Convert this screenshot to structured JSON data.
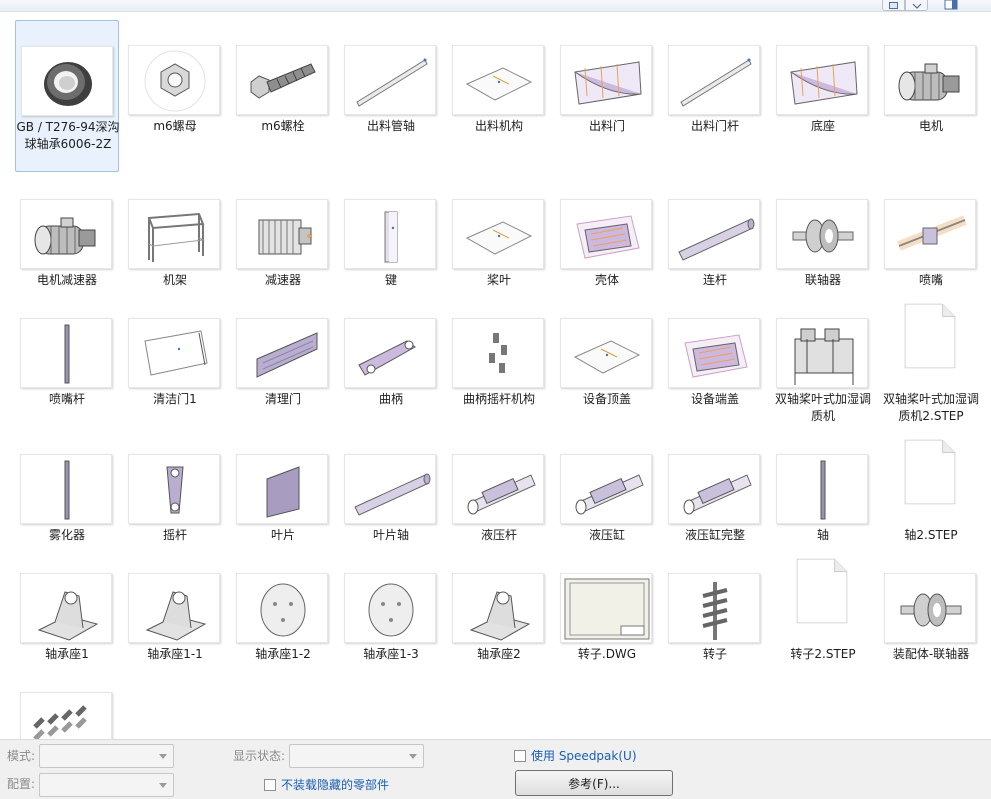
{
  "files": [
    {
      "label": "GB / T276-94深沟球轴承6006-2Z",
      "icon": "bearing-icon",
      "selected": true
    },
    {
      "label": "m6螺母",
      "icon": "nut-icon"
    },
    {
      "label": "m6螺栓",
      "icon": "bolt-icon"
    },
    {
      "label": "出料管轴",
      "icon": "rod-icon"
    },
    {
      "label": "出料机构",
      "icon": "sheet-icon"
    },
    {
      "label": "出料门",
      "icon": "trough-icon"
    },
    {
      "label": "出料门杆",
      "icon": "rod-icon"
    },
    {
      "label": "底座",
      "icon": "trough-icon"
    },
    {
      "label": "电机",
      "icon": "motor-icon"
    },
    {
      "label": "电机减速器",
      "icon": "motor-icon"
    },
    {
      "label": "机架",
      "icon": "frame-icon"
    },
    {
      "label": "减速器",
      "icon": "gearbox-icon"
    },
    {
      "label": "键",
      "icon": "key-icon"
    },
    {
      "label": "桨叶",
      "icon": "sheet-icon"
    },
    {
      "label": "壳体",
      "icon": "housing-icon"
    },
    {
      "label": "连杆",
      "icon": "shaft-icon"
    },
    {
      "label": "联轴器",
      "icon": "coupling-icon"
    },
    {
      "label": "喷嘴",
      "icon": "nozzle-icon"
    },
    {
      "label": "喷嘴杆",
      "icon": "vertical-rod-icon"
    },
    {
      "label": "清洁门1",
      "icon": "panel-icon"
    },
    {
      "label": "清理门",
      "icon": "plate-icon"
    },
    {
      "label": "曲柄",
      "icon": "crank-icon"
    },
    {
      "label": "曲柄摇杆机构",
      "icon": "linkage-icon"
    },
    {
      "label": "设备顶盖",
      "icon": "sheet-icon"
    },
    {
      "label": "设备端盖",
      "icon": "housing-icon"
    },
    {
      "label": "双轴桨叶式加湿调质机",
      "icon": "machine-icon"
    },
    {
      "label": "双轴桨叶式加湿调质机2.STEP",
      "icon": "document-icon"
    },
    {
      "label": "雾化器",
      "icon": "vertical-rod-icon"
    },
    {
      "label": "摇杆",
      "icon": "rocker-icon"
    },
    {
      "label": "叶片",
      "icon": "blade-icon"
    },
    {
      "label": "叶片轴",
      "icon": "shaft-icon"
    },
    {
      "label": "液压杆",
      "icon": "cylinder-icon"
    },
    {
      "label": "液压缸",
      "icon": "cylinder-icon"
    },
    {
      "label": "液压缸完整",
      "icon": "cylinder-icon"
    },
    {
      "label": "轴",
      "icon": "vertical-rod-icon"
    },
    {
      "label": "轴2.STEP",
      "icon": "document-icon"
    },
    {
      "label": "轴承座1",
      "icon": "bearing-block-icon"
    },
    {
      "label": "轴承座1-1",
      "icon": "bearing-block-icon"
    },
    {
      "label": "轴承座1-2",
      "icon": "disc-icon"
    },
    {
      "label": "轴承座1-3",
      "icon": "disc-icon"
    },
    {
      "label": "轴承座2",
      "icon": "bearing-block-icon"
    },
    {
      "label": "转子.DWG",
      "icon": "drawing-icon"
    },
    {
      "label": "转子",
      "icon": "rotor-icon"
    },
    {
      "label": "转子2.STEP",
      "icon": "document-icon"
    },
    {
      "label": "装配体-联轴器",
      "icon": "coupling-icon"
    },
    {
      "label": "",
      "icon": "paddles-icon"
    }
  ],
  "footer": {
    "mode_label": "模式:",
    "config_label": "配置:",
    "display_state_label": "显示状态:",
    "speedpak_label": "使用 Speedpak(U)",
    "hidden_parts_label": "不装载隐藏的零部件",
    "references_button": "参考(F)..."
  }
}
